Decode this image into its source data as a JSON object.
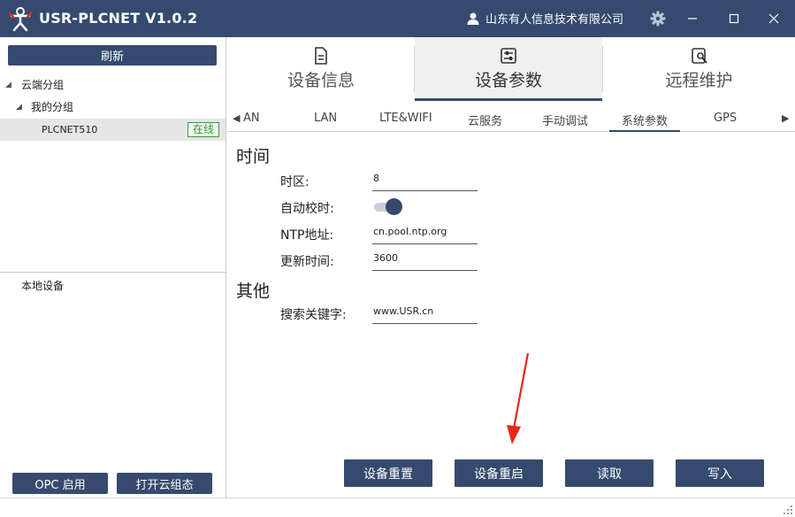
{
  "titlebar": {
    "title": "USR-PLCNET V1.0.2",
    "company": "山东有人信息技术有限公司",
    "icons": [
      "logo-icon",
      "user-icon",
      "gear-icon",
      "minimize-icon",
      "maximize-icon",
      "close-icon"
    ]
  },
  "left": {
    "refresh_label": "刷新",
    "tree": {
      "root_label": "云端分组",
      "group_label": "我的分组",
      "device": {
        "name": "PLCNET510",
        "status": "在线"
      }
    },
    "local_label": "本地设备",
    "opc_button": "OPC 启用",
    "cloud_button": "打开云组态"
  },
  "main_tabs": [
    {
      "label": "设备信息",
      "icon": "document-icon",
      "active": false
    },
    {
      "label": "设备参数",
      "icon": "sliders-icon",
      "active": true
    },
    {
      "label": "远程维护",
      "icon": "wrench-icon",
      "active": false
    }
  ],
  "sub_tabs": [
    {
      "label": "AN",
      "active": false
    },
    {
      "label": "LAN",
      "active": false
    },
    {
      "label": "LTE&WIFI",
      "active": false
    },
    {
      "label": "云服务",
      "active": false
    },
    {
      "label": "手动调试",
      "active": false
    },
    {
      "label": "系统参数",
      "active": true
    },
    {
      "label": "GPS",
      "active": false
    }
  ],
  "form": {
    "time_section": "时间",
    "timezone_label": "时区:",
    "timezone_value": "8",
    "auto_sync_label": "自动校时:",
    "auto_sync_on": true,
    "ntp_label": "NTP地址:",
    "ntp_value": "cn.pool.ntp.org",
    "update_label": "更新时间:",
    "update_value": "3600",
    "other_section": "其他",
    "keyword_label": "搜索关键字:",
    "keyword_value": "www.USR.cn"
  },
  "actions": {
    "reset": "设备重置",
    "reboot": "设备重启",
    "read": "读取",
    "write": "写入"
  },
  "colors": {
    "primary": "#354a6e",
    "online_green": "#3a9a3a",
    "annotation_red": "#e8261c"
  }
}
